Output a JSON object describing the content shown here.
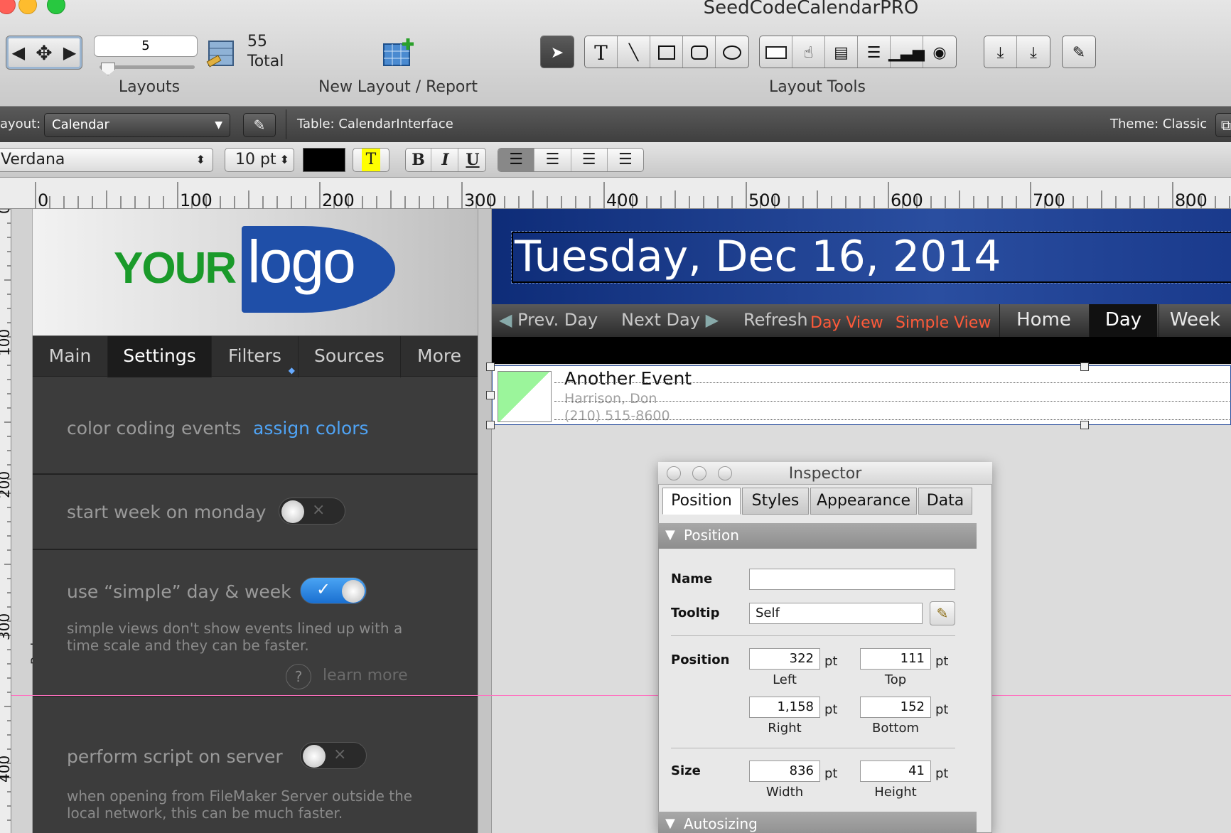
{
  "window": {
    "title": "SeedCodeCalendarPRO"
  },
  "toolbar": {
    "record_value": "5",
    "layouts_label": "Layouts",
    "total_count": "55",
    "total_label": "Total",
    "new_layout_label": "New Layout / Report",
    "layout_tools_label": "Layout Tools",
    "tool_text_glyph": "T"
  },
  "layoutbar": {
    "layout_label": "ayout:",
    "layout_value": "Calendar",
    "table_text": "Table:  CalendarInterface",
    "theme_text": "Theme: Classic"
  },
  "formatbar": {
    "font": "Verdana",
    "size": "10 pt",
    "text_color": "#000000",
    "highlight_glyph": "T",
    "bold": "B",
    "italic": "I",
    "underline": "U"
  },
  "ruler": {
    "h_labels": [
      "0",
      "100",
      "200",
      "300",
      "400",
      "500",
      "600",
      "700",
      "800"
    ],
    "v_labels": [
      "0",
      "100",
      "200",
      "300",
      "400"
    ]
  },
  "part_label": "Body",
  "left_panel": {
    "logo_your": "YOUR",
    "logo_logo": "logo",
    "tabs": [
      "Main",
      "Settings",
      "Filters",
      "Sources",
      "More"
    ],
    "active_tab": "Settings",
    "color_coding_label": "color coding events",
    "assign_colors": "assign colors",
    "start_week_label": "start week on monday",
    "simple_label": "use “simple” day & week",
    "simple_desc_1": "simple views don't show events lined up with a",
    "simple_desc_2": "time scale and they can be faster.",
    "help_glyph": "?",
    "learn_more": "learn more",
    "perform_label": "perform script on server",
    "perform_desc_1": "when opening from FileMaker Server outside the",
    "perform_desc_2": "local network, this can be much faster.",
    "toggle_off_glyph": "×",
    "toggle_on_glyph": "✓"
  },
  "calendar": {
    "date_title": "Tuesday, Dec 16, 2014",
    "prev_day": "Prev. Day",
    "next_day": "Next Day",
    "refresh": "Refresh",
    "day_view": "Day View",
    "simple_view": "Simple View",
    "buttons": [
      "Home",
      "Day",
      "Week"
    ],
    "active_button": "Day",
    "event": {
      "title": "Another Event",
      "contact": "Harrison, Don",
      "phone": "(210) 515-8600",
      "color": "#9bf59b"
    }
  },
  "inspector": {
    "title": "Inspector",
    "tabs": [
      "Position",
      "Styles",
      "Appearance",
      "Data"
    ],
    "active_tab": "Position",
    "section_position": "Position",
    "section_autosizing": "Autosizing",
    "name_label": "Name",
    "name_value": "",
    "tooltip_label": "Tooltip",
    "tooltip_value": "Self",
    "position_label": "Position",
    "left": "322",
    "left_caption": "Left",
    "top": "111",
    "top_caption": "Top",
    "right": "1,158",
    "right_caption": "Right",
    "bottom": "152",
    "bottom_caption": "Bottom",
    "size_label": "Size",
    "width": "836",
    "width_caption": "Width",
    "height": "41",
    "height_caption": "Height",
    "unit": "pt"
  }
}
